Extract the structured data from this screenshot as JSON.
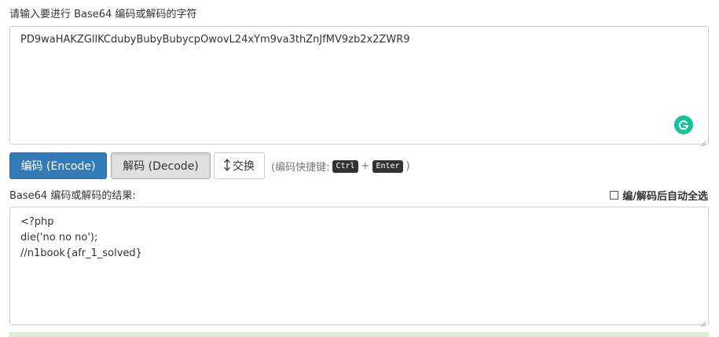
{
  "input_section": {
    "label": "请输入要进行 Base64 编码或解码的字符",
    "value": "PD9waHAKZGllKCdubyBubyBubycpOwovL24xYm9va3thZnJfMV9zb2x2ZWR9"
  },
  "toolbar": {
    "encode_label": "编码 (Encode)",
    "decode_label": "解码 (Decode)",
    "swap_label": "交换",
    "hint_prefix": "(编码快捷键:",
    "hint_key1": "Ctrl",
    "hint_plus": "+",
    "hint_key2": "Enter",
    "hint_suffix": ")"
  },
  "output_section": {
    "label": "Base64 编码或解码的结果:",
    "auto_select_label": "编/解码后自动全选",
    "auto_select_checked": false,
    "lines": [
      "<?php",
      "die('no no no');",
      "//n1book{afr_1_solved}"
    ]
  },
  "colors": {
    "primary": "#337ab7",
    "grammarly": "#15c39a",
    "success_bg": "#dff0d8"
  },
  "icons": {
    "grammarly": "grammarly-icon",
    "swap": "swap-vertical-icon",
    "resize": "resize-handle-icon"
  }
}
